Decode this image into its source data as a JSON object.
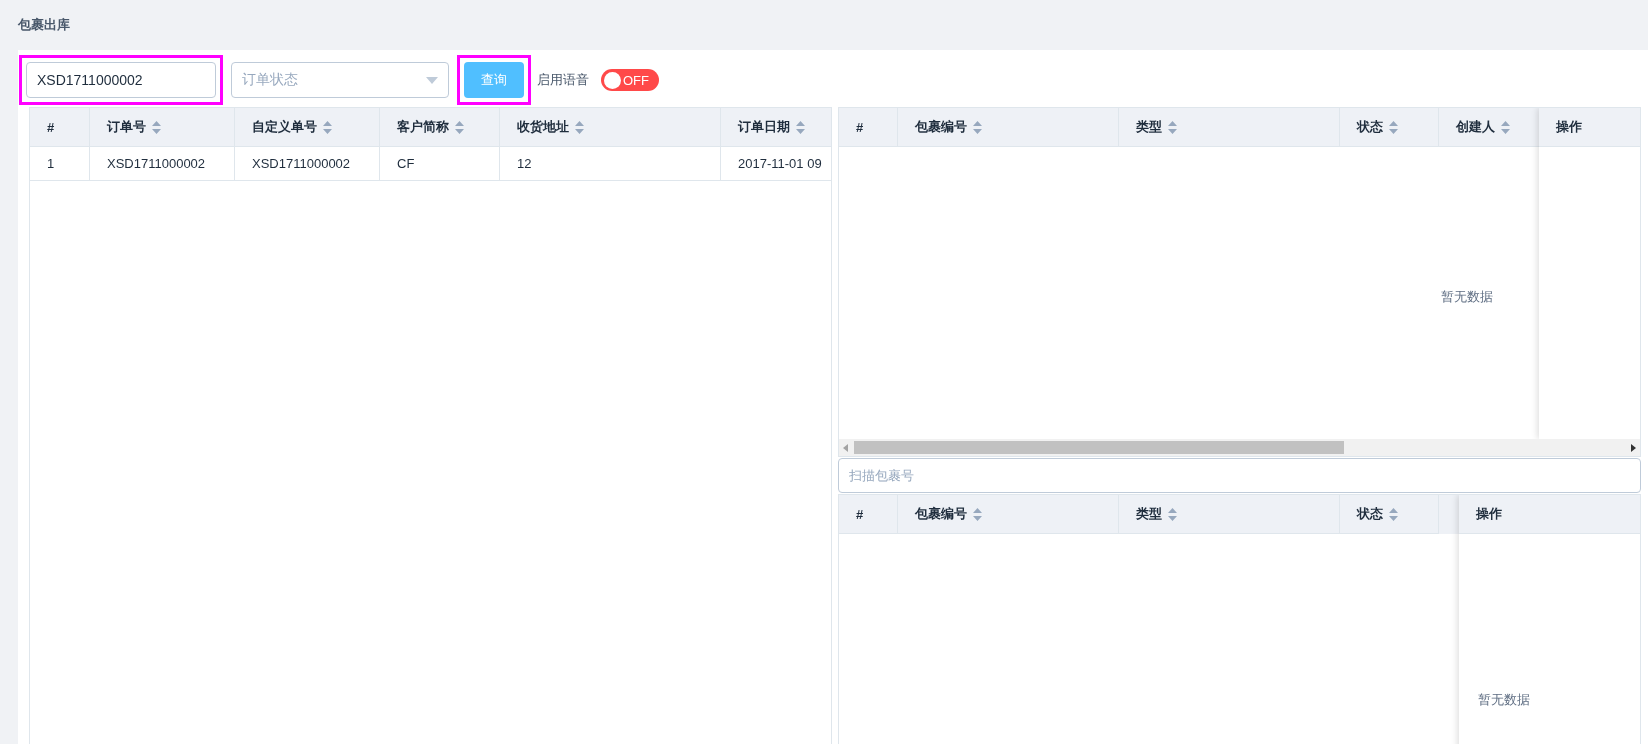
{
  "page_title": "包裹出库",
  "toolbar": {
    "order_input": {
      "value": "XSD1711000002",
      "highlighted": true
    },
    "status_select": {
      "placeholder": "订单状态"
    },
    "query_button": {
      "label": "查询",
      "highlighted": true
    },
    "voice_toggle": {
      "label": "启用语音",
      "on": false,
      "text": "OFF"
    }
  },
  "orders_table": {
    "columns": [
      {
        "label": "#",
        "sortable": false
      },
      {
        "label": "订单号",
        "sortable": true
      },
      {
        "label": "自定义单号",
        "sortable": true
      },
      {
        "label": "客户简称",
        "sortable": true
      },
      {
        "label": "收货地址",
        "sortable": true
      },
      {
        "label": "订单日期",
        "sortable": true
      }
    ],
    "rows": [
      [
        "1",
        "XSD1711000002",
        "XSD1711000002",
        "CF",
        "12",
        "2017-11-01 09"
      ]
    ]
  },
  "packages_table": {
    "columns": [
      {
        "label": "#",
        "sortable": false
      },
      {
        "label": "包裹编号",
        "sortable": true
      },
      {
        "label": "类型",
        "sortable": true
      },
      {
        "label": "状态",
        "sortable": true
      },
      {
        "label": "创建人",
        "sortable": true
      }
    ],
    "fixed_column": "操作",
    "empty_text": "暂无数据"
  },
  "scan_input": {
    "placeholder": "扫描包裹号"
  },
  "scanned_table": {
    "columns": [
      {
        "label": "#",
        "sortable": false
      },
      {
        "label": "包裹编号",
        "sortable": true
      },
      {
        "label": "类型",
        "sortable": true
      },
      {
        "label": "状态",
        "sortable": true
      }
    ],
    "fixed_column": "操作",
    "empty_text": "暂无数据"
  }
}
